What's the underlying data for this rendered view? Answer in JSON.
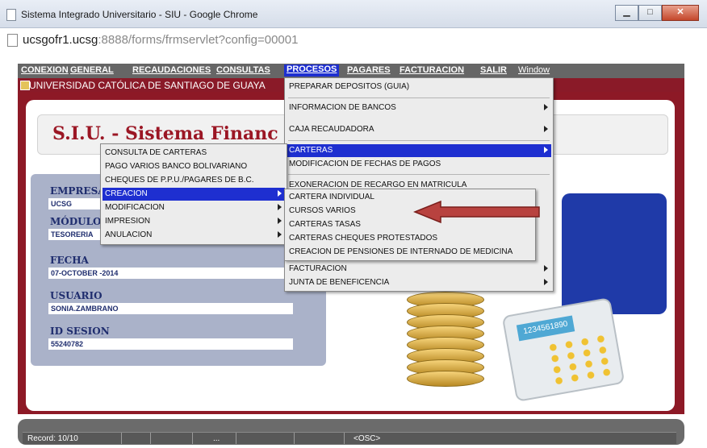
{
  "window": {
    "title": "Sistema Integrado Universitario - SIU - Google Chrome",
    "minimize": "▁",
    "maximize": "□",
    "close": "✕"
  },
  "address": {
    "host": "ucsgofr1.ucsg",
    "rest": ":8888/forms/frmservlet?config=00001"
  },
  "menubar": [
    "CONEXION",
    "GENERAL",
    "RECAUDACIONES",
    "CONSULTAS",
    "PROCESOS",
    "PAGARES",
    "FACTURACION",
    "SALIR",
    "Window"
  ],
  "form_title": "UNIVERSIDAD CATÓLICA DE SANTIAGO DE GUAYA",
  "system_name": "S.I.U. - Sistema Financ",
  "fields": {
    "empresa_label": "EMPRESA",
    "empresa_value": "UCSG",
    "modulo_label": "MÓDULO",
    "modulo_value": "TESORERIA",
    "fecha_label": "FECHA",
    "fecha_value": "07-OCTOBER -2014",
    "usuario_label": "USUARIO",
    "usuario_value": "SONIA.ZAMBRANO",
    "sesion_label": "ID SESION",
    "sesion_value": "55240782"
  },
  "procesos_menu": [
    "PREPARAR DEPOSITOS (GUIA)",
    "INFORMACION DE BANCOS",
    "CAJA RECAUDADORA",
    "CARTERAS",
    "MODIFICACION DE FECHAS DE PAGOS",
    "EXONERACION DE RECARGO EN MATRICULA",
    "FACTURACION",
    "JUNTA DE BENEFICENCIA"
  ],
  "carteras_menu": [
    "CONSULTA DE CARTERAS",
    "PAGO VARIOS BANCO BOLIVARIANO",
    "CHEQUES DE P.P.U./PAGARES DE B.C.",
    "CREACION",
    "MODIFICACION",
    "IMPRESION",
    "ANULACION"
  ],
  "creacion_menu": [
    "CARTERA INDIVIDUAL",
    "CURSOS VARIOS",
    "CARTERAS TASAS",
    "CARTERAS CHEQUES PROTESTADOS",
    "CREACION DE PENSIONES DE INTERNADO DE MEDICINA"
  ],
  "calculator_display": "1234561890",
  "status": {
    "record": "Record: 10/10",
    "ellipsis": "...",
    "osc": "<OSC>"
  }
}
